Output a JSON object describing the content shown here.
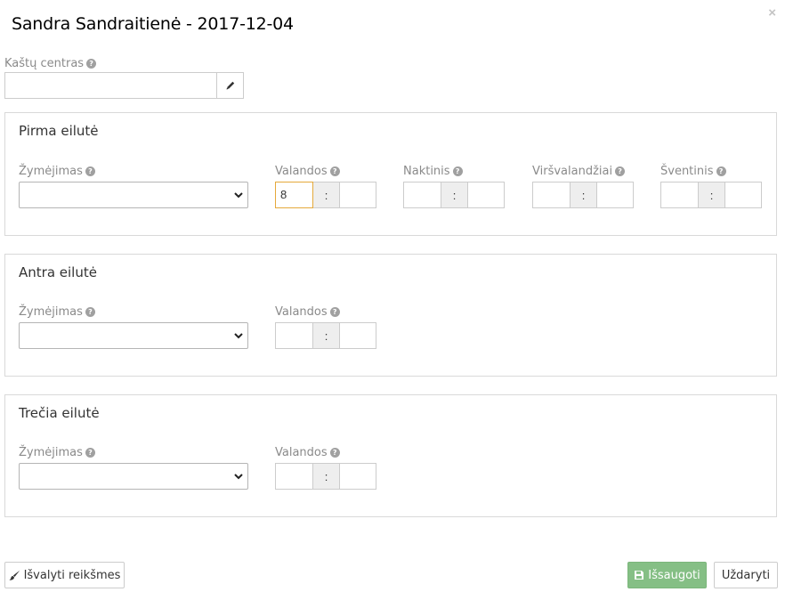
{
  "dialog": {
    "title": "Sandra Sandraitienė - 2017-12-04",
    "close_symbol": "×"
  },
  "cost_center": {
    "label": "Kaštų centras",
    "value": "",
    "edit_icon": "pencil-icon"
  },
  "rows": [
    {
      "title": "Pirma eilutė",
      "marking_label": "Žymėjimas",
      "marking_value": "",
      "fields": [
        {
          "label": "Valandos",
          "hours": "8",
          "minutes": "",
          "separator": ":"
        },
        {
          "label": "Naktinis",
          "hours": "",
          "minutes": "",
          "separator": ":"
        },
        {
          "label": "Viršvalandžiai",
          "hours": "",
          "minutes": "",
          "separator": ":"
        },
        {
          "label": "Šventinis",
          "hours": "",
          "minutes": "",
          "separator": ":"
        }
      ]
    },
    {
      "title": "Antra eilutė",
      "marking_label": "Žymėjimas",
      "marking_value": "",
      "fields": [
        {
          "label": "Valandos",
          "hours": "",
          "minutes": "",
          "separator": ":"
        }
      ]
    },
    {
      "title": "Trečia eilutė",
      "marking_label": "Žymėjimas",
      "marking_value": "",
      "fields": [
        {
          "label": "Valandos",
          "hours": "",
          "minutes": "",
          "separator": ":"
        }
      ]
    }
  ],
  "footer": {
    "clear_label": "Išvalyti reikšmes",
    "save_label": "Išsaugoti",
    "close_label": "Uždaryti"
  },
  "help_symbol": "?",
  "colors": {
    "primary_button": "#85bf85",
    "active_input_border": "#e5a93b"
  }
}
